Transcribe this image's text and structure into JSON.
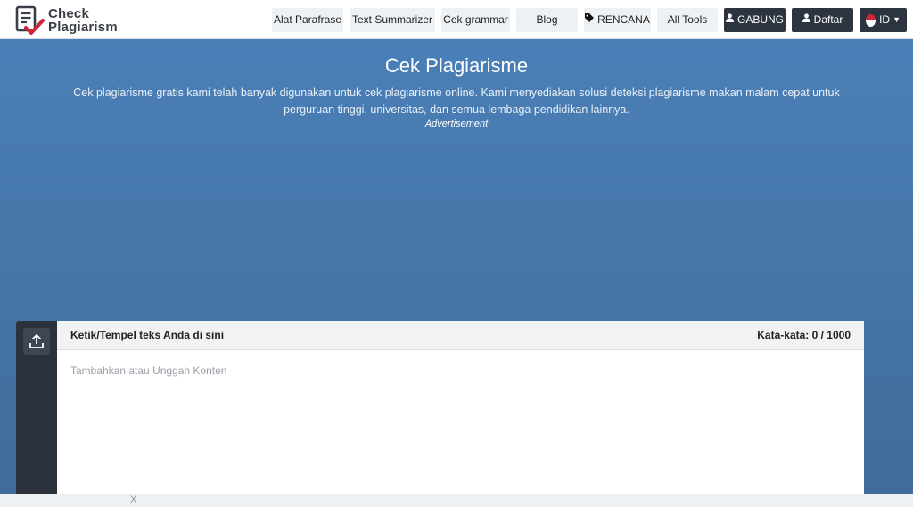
{
  "brand": {
    "line1": "Check",
    "line2": "Plagiarism",
    "accent_color": "#d0273a",
    "text_color": "#3a3f47"
  },
  "nav": {
    "items": [
      {
        "label": "Alat Parafrase"
      },
      {
        "label": "Text Summarizer"
      },
      {
        "label": "Cek grammar"
      },
      {
        "label": "Blog"
      },
      {
        "label": "RENCANA",
        "icon": "tag-icon"
      },
      {
        "label": "All Tools"
      },
      {
        "label": "GABUNG",
        "icon": "user-icon"
      },
      {
        "label": "Daftar",
        "icon": "user-icon"
      }
    ],
    "language": {
      "label": "ID",
      "icon": "indonesia-flag-icon"
    }
  },
  "hero": {
    "title": "Cek Plagiarisme",
    "description": "Cek plagiarisme gratis kami telah banyak digunakan untuk cek plagiarisme online. Kami menyediakan solusi deteksi plagiarisme makan malam cepat untuk perguruan tinggi, universitas, dan semua lembaga pendidikan lainnya.",
    "ad_label": "Advertisement"
  },
  "editor": {
    "hint": "Ketik/Tempel teks Anda di sini",
    "word_count": "Kata-kata: 0 / 1000",
    "placeholder": "Tambahkan atau Unggah Konten",
    "value": "",
    "upload_icon": "upload-icon"
  },
  "bottom_ad": {
    "close": "X"
  },
  "colors": {
    "hero_top": "#4a7fb7",
    "hero_bottom": "#3f6c99",
    "dark_button": "#2c3440",
    "rail": "#2b323c"
  }
}
